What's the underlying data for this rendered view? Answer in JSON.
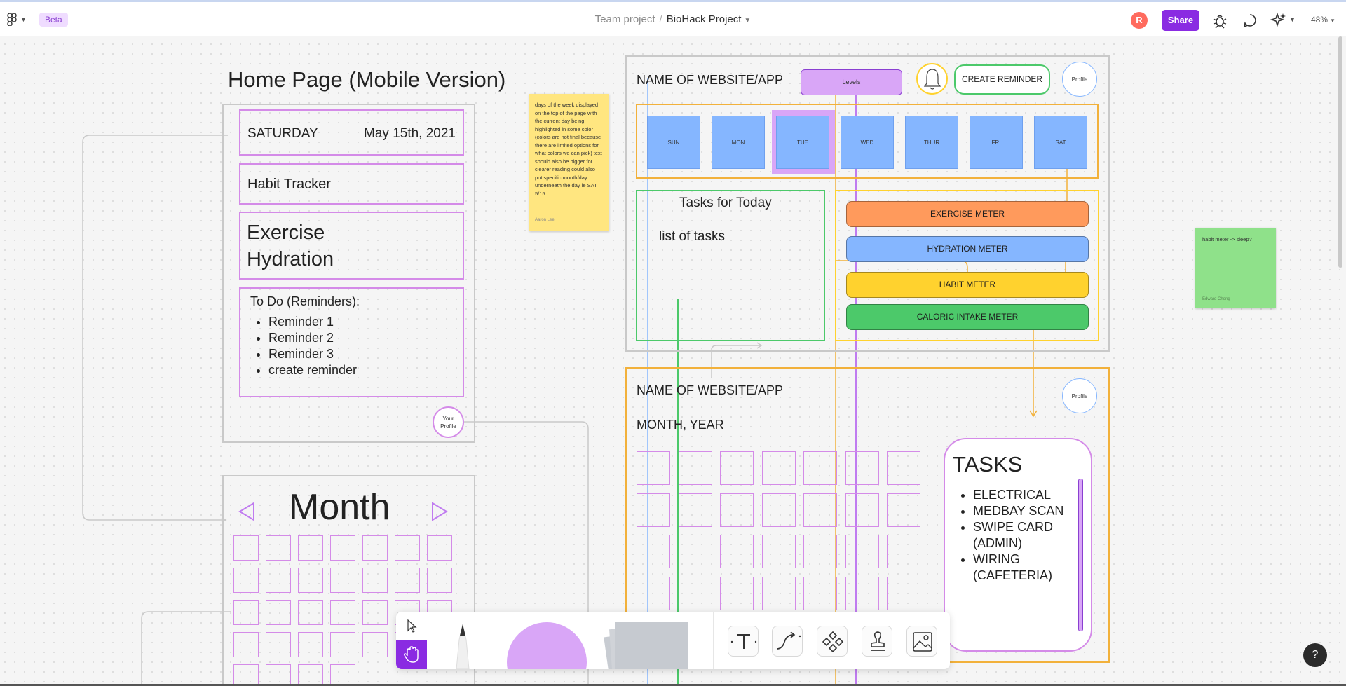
{
  "topbar": {
    "beta_label": "Beta",
    "team_name": "Team project",
    "separator": "/",
    "project_name": "BioHack Project",
    "avatar_initial": "R",
    "share_label": "Share",
    "zoom_level": "48%"
  },
  "canvas": {
    "home_title": "Home Page (Mobile Version)",
    "mobile": {
      "day": "SATURDAY",
      "date": "May 15th, 2021",
      "habit_tracker": "Habit Tracker",
      "exercise": "Exercise",
      "hydration": "Hydration",
      "todo_title": "To Do (Reminders):",
      "todo_items": [
        "Reminder 1",
        "Reminder 2",
        "Reminder 3",
        "create reminder"
      ],
      "profile_line1": "Your",
      "profile_line2": "Profile"
    },
    "month_label": "Month",
    "sticky_yellow": {
      "text": "days of the week displayed on the top of the page with the current day being highlighted in some color (colors are not final because there are limited options for what colors we can pick) text should also be bigger for clearer reading could also put specific month/day underneath the day ie SAT 5/15",
      "author": "Aaron Lee"
    },
    "sticky_green": {
      "text": "habit meter -> sleep?",
      "author": "Edward Chong"
    },
    "desktop": {
      "site_name": "NAME OF WEBSITE/APP",
      "levels": "Levels",
      "create_reminder": "CREATE REMINDER",
      "profile": "Profile",
      "days": [
        "SUN",
        "MON",
        "TUE",
        "WED",
        "THUR",
        "FRI",
        "SAT"
      ],
      "tasks_title": "Tasks for Today",
      "tasks_sub": "list of tasks",
      "meters": [
        {
          "label": "EXERCISE METER",
          "color": "#ff9a5c"
        },
        {
          "label": "HYDRATION METER",
          "color": "#85b6ff"
        },
        {
          "label": "HABIT METER",
          "color": "#ffd22e"
        },
        {
          "label": "CALORIC INTAKE METER",
          "color": "#4cc96a"
        }
      ]
    },
    "calendar": {
      "site_name": "NAME OF WEBSITE/APP",
      "month_year": "MONTH, YEAR",
      "profile": "Profile",
      "tasks_title": "TASKS",
      "tasks": [
        "ELECTRICAL",
        "MEDBAY SCAN",
        "SWIPE CARD (ADMIN)",
        "WIRING (CAFETERIA)"
      ]
    }
  },
  "toolbar": {
    "tools": [
      "move-tool",
      "hand-tool",
      "pen-tool",
      "shape-tool",
      "sticky-tool",
      "text-tool",
      "connector-tool",
      "component-tool",
      "stamp-tool",
      "image-tool"
    ]
  },
  "help_label": "?",
  "colors": {
    "accent": "#8a2be2",
    "pink_outline": "#d48be8",
    "orange_outline": "#f2b13b",
    "green_outline": "#4cc96a",
    "blue_outline": "#85b6ff"
  }
}
